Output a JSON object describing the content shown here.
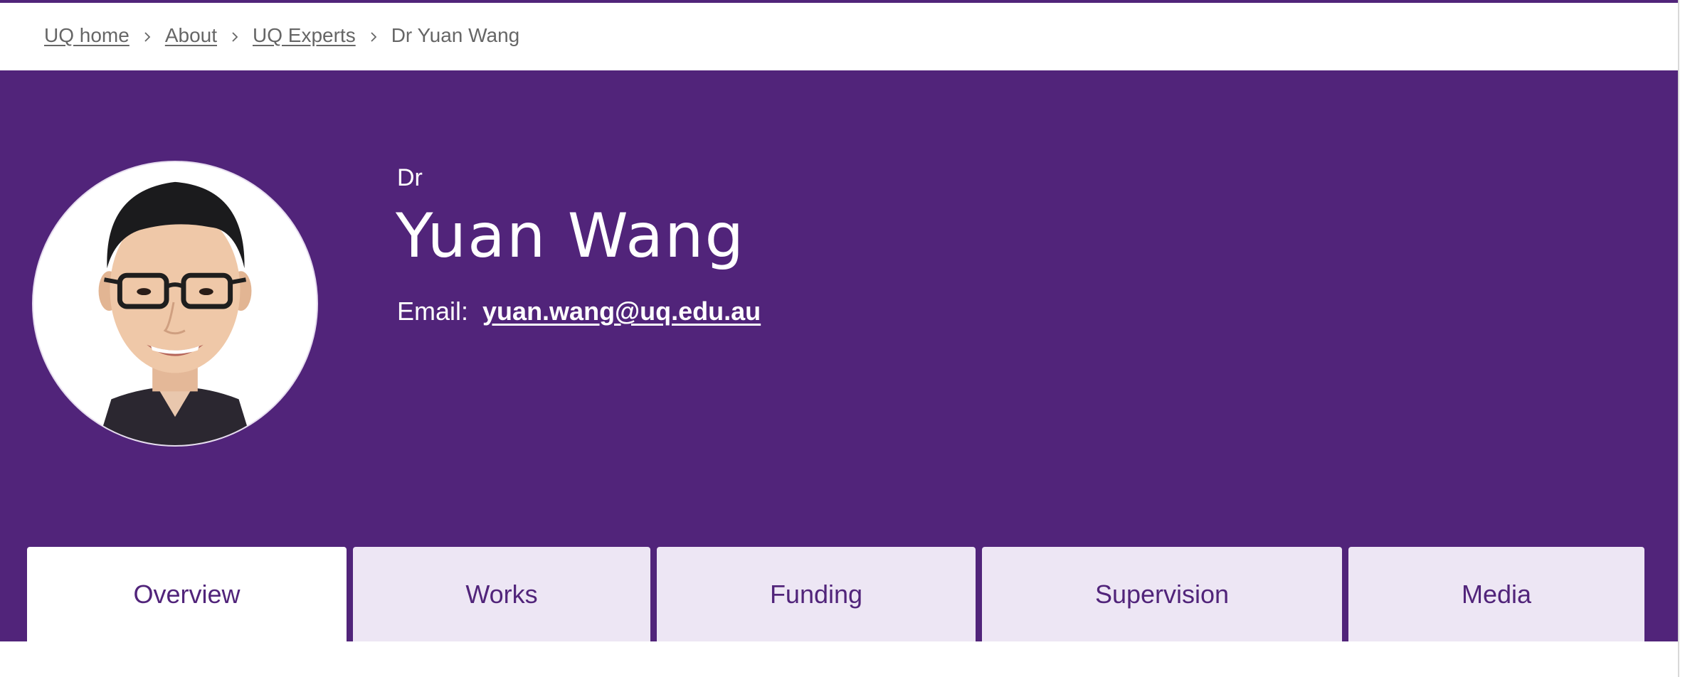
{
  "breadcrumb": {
    "items": [
      {
        "label": "UQ home"
      },
      {
        "label": "About"
      },
      {
        "label": "UQ Experts"
      }
    ],
    "current": "Dr Yuan Wang"
  },
  "profile": {
    "honorific": "Dr",
    "name": "Yuan Wang",
    "email_label": "Email:",
    "email": "yuan.wang@uq.edu.au"
  },
  "tabs": [
    {
      "label": "Overview",
      "active": true
    },
    {
      "label": "Works",
      "active": false
    },
    {
      "label": "Funding",
      "active": false
    },
    {
      "label": "Supervision",
      "active": false
    },
    {
      "label": "Media",
      "active": false
    }
  ],
  "colors": {
    "brand": "#51247a",
    "tab_bg": "#ede6f4",
    "text_muted": "#666666"
  },
  "icons": {
    "breadcrumb_separator": "chevron-right-icon"
  }
}
